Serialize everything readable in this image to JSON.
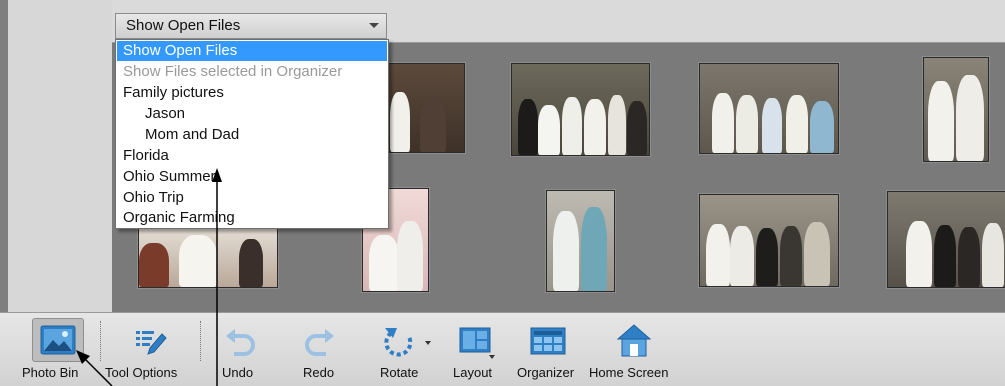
{
  "dropdown": {
    "selected": "Show Open Files",
    "options": [
      {
        "label": "Show Open Files",
        "state": "selected"
      },
      {
        "label": "Show Files selected in Organizer",
        "state": "disabled"
      },
      {
        "label": "Family pictures",
        "state": "normal"
      },
      {
        "label": "Jason",
        "state": "normal"
      },
      {
        "label": "Mom and Dad",
        "state": "normal"
      },
      {
        "label": "Florida",
        "state": "normal"
      },
      {
        "label": "Ohio Summer",
        "state": "normal"
      },
      {
        "label": "Ohio Trip",
        "state": "normal"
      },
      {
        "label": "Organic Farming",
        "state": "normal"
      }
    ]
  },
  "toolbar": {
    "photo_bin": "Photo Bin",
    "tool_options": "Tool Options",
    "undo": "Undo",
    "redo": "Redo",
    "rotate": "Rotate",
    "layout": "Layout",
    "organizer": "Organizer",
    "home_screen": "Home Screen"
  },
  "icons": {
    "photo_bin": "photo-bin-icon",
    "tool_options": "tool-options-icon",
    "undo": "undo-icon",
    "redo": "redo-icon",
    "rotate": "rotate-icon",
    "layout": "layout-icon",
    "organizer": "organizer-icon",
    "home_screen": "home-icon"
  },
  "colors": {
    "selection_blue": "#3399ff",
    "icon_blue": "#2f7fc6",
    "photo_area": "#7a7a7a"
  }
}
